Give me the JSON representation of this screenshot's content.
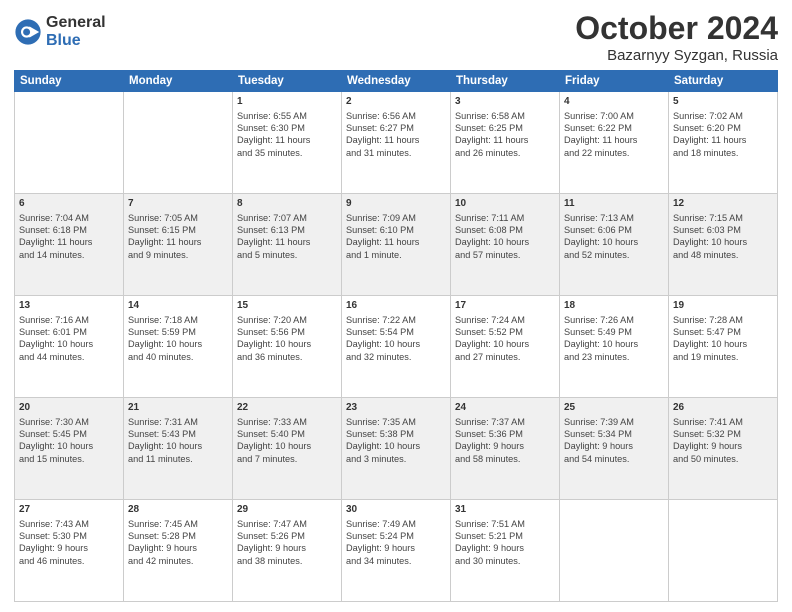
{
  "header": {
    "logo_general": "General",
    "logo_blue": "Blue",
    "month_title": "October 2024",
    "location": "Bazarnyy Syzgan, Russia"
  },
  "days_of_week": [
    "Sunday",
    "Monday",
    "Tuesday",
    "Wednesday",
    "Thursday",
    "Friday",
    "Saturday"
  ],
  "weeks": [
    [
      {
        "num": "",
        "detail": ""
      },
      {
        "num": "",
        "detail": ""
      },
      {
        "num": "1",
        "detail": "Sunrise: 6:55 AM\nSunset: 6:30 PM\nDaylight: 11 hours\nand 35 minutes."
      },
      {
        "num": "2",
        "detail": "Sunrise: 6:56 AM\nSunset: 6:27 PM\nDaylight: 11 hours\nand 31 minutes."
      },
      {
        "num": "3",
        "detail": "Sunrise: 6:58 AM\nSunset: 6:25 PM\nDaylight: 11 hours\nand 26 minutes."
      },
      {
        "num": "4",
        "detail": "Sunrise: 7:00 AM\nSunset: 6:22 PM\nDaylight: 11 hours\nand 22 minutes."
      },
      {
        "num": "5",
        "detail": "Sunrise: 7:02 AM\nSunset: 6:20 PM\nDaylight: 11 hours\nand 18 minutes."
      }
    ],
    [
      {
        "num": "6",
        "detail": "Sunrise: 7:04 AM\nSunset: 6:18 PM\nDaylight: 11 hours\nand 14 minutes."
      },
      {
        "num": "7",
        "detail": "Sunrise: 7:05 AM\nSunset: 6:15 PM\nDaylight: 11 hours\nand 9 minutes."
      },
      {
        "num": "8",
        "detail": "Sunrise: 7:07 AM\nSunset: 6:13 PM\nDaylight: 11 hours\nand 5 minutes."
      },
      {
        "num": "9",
        "detail": "Sunrise: 7:09 AM\nSunset: 6:10 PM\nDaylight: 11 hours\nand 1 minute."
      },
      {
        "num": "10",
        "detail": "Sunrise: 7:11 AM\nSunset: 6:08 PM\nDaylight: 10 hours\nand 57 minutes."
      },
      {
        "num": "11",
        "detail": "Sunrise: 7:13 AM\nSunset: 6:06 PM\nDaylight: 10 hours\nand 52 minutes."
      },
      {
        "num": "12",
        "detail": "Sunrise: 7:15 AM\nSunset: 6:03 PM\nDaylight: 10 hours\nand 48 minutes."
      }
    ],
    [
      {
        "num": "13",
        "detail": "Sunrise: 7:16 AM\nSunset: 6:01 PM\nDaylight: 10 hours\nand 44 minutes."
      },
      {
        "num": "14",
        "detail": "Sunrise: 7:18 AM\nSunset: 5:59 PM\nDaylight: 10 hours\nand 40 minutes."
      },
      {
        "num": "15",
        "detail": "Sunrise: 7:20 AM\nSunset: 5:56 PM\nDaylight: 10 hours\nand 36 minutes."
      },
      {
        "num": "16",
        "detail": "Sunrise: 7:22 AM\nSunset: 5:54 PM\nDaylight: 10 hours\nand 32 minutes."
      },
      {
        "num": "17",
        "detail": "Sunrise: 7:24 AM\nSunset: 5:52 PM\nDaylight: 10 hours\nand 27 minutes."
      },
      {
        "num": "18",
        "detail": "Sunrise: 7:26 AM\nSunset: 5:49 PM\nDaylight: 10 hours\nand 23 minutes."
      },
      {
        "num": "19",
        "detail": "Sunrise: 7:28 AM\nSunset: 5:47 PM\nDaylight: 10 hours\nand 19 minutes."
      }
    ],
    [
      {
        "num": "20",
        "detail": "Sunrise: 7:30 AM\nSunset: 5:45 PM\nDaylight: 10 hours\nand 15 minutes."
      },
      {
        "num": "21",
        "detail": "Sunrise: 7:31 AM\nSunset: 5:43 PM\nDaylight: 10 hours\nand 11 minutes."
      },
      {
        "num": "22",
        "detail": "Sunrise: 7:33 AM\nSunset: 5:40 PM\nDaylight: 10 hours\nand 7 minutes."
      },
      {
        "num": "23",
        "detail": "Sunrise: 7:35 AM\nSunset: 5:38 PM\nDaylight: 10 hours\nand 3 minutes."
      },
      {
        "num": "24",
        "detail": "Sunrise: 7:37 AM\nSunset: 5:36 PM\nDaylight: 9 hours\nand 58 minutes."
      },
      {
        "num": "25",
        "detail": "Sunrise: 7:39 AM\nSunset: 5:34 PM\nDaylight: 9 hours\nand 54 minutes."
      },
      {
        "num": "26",
        "detail": "Sunrise: 7:41 AM\nSunset: 5:32 PM\nDaylight: 9 hours\nand 50 minutes."
      }
    ],
    [
      {
        "num": "27",
        "detail": "Sunrise: 7:43 AM\nSunset: 5:30 PM\nDaylight: 9 hours\nand 46 minutes."
      },
      {
        "num": "28",
        "detail": "Sunrise: 7:45 AM\nSunset: 5:28 PM\nDaylight: 9 hours\nand 42 minutes."
      },
      {
        "num": "29",
        "detail": "Sunrise: 7:47 AM\nSunset: 5:26 PM\nDaylight: 9 hours\nand 38 minutes."
      },
      {
        "num": "30",
        "detail": "Sunrise: 7:49 AM\nSunset: 5:24 PM\nDaylight: 9 hours\nand 34 minutes."
      },
      {
        "num": "31",
        "detail": "Sunrise: 7:51 AM\nSunset: 5:21 PM\nDaylight: 9 hours\nand 30 minutes."
      },
      {
        "num": "",
        "detail": ""
      },
      {
        "num": "",
        "detail": ""
      }
    ]
  ]
}
